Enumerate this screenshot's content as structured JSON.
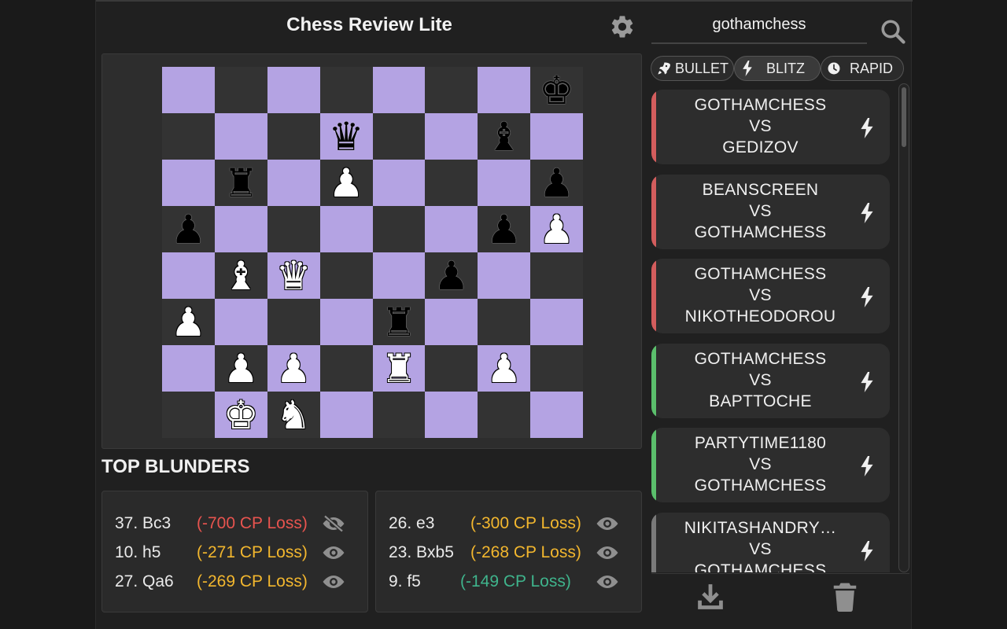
{
  "header": {
    "title": "Chess Review Lite",
    "settings_icon": "gear-icon"
  },
  "colors": {
    "light_square": "#b4a3e3",
    "dark_square": "#333333",
    "loss_red": "#e8544f",
    "loss_orange": "#f3b72e",
    "loss_green": "#3fb48c",
    "win_stripe": "#5bbf6c",
    "loss_stripe": "#d35d5d",
    "draw_stripe": "#7a7a7a"
  },
  "board": {
    "ranks": [
      [
        "",
        "",
        "",
        "",
        "",
        "",
        "",
        "bk"
      ],
      [
        "",
        "",
        "",
        "bq",
        "",
        "",
        "bb",
        ""
      ],
      [
        "",
        "br",
        "",
        "wp",
        "",
        "",
        "",
        "bp"
      ],
      [
        "bp",
        "",
        "",
        "",
        "",
        "",
        "bp",
        "wp"
      ],
      [
        "",
        "wb",
        "wq",
        "",
        "",
        "bp",
        "",
        ""
      ],
      [
        "wp",
        "",
        "",
        "",
        "br",
        "",
        "",
        ""
      ],
      [
        "",
        "wp",
        "wp",
        "",
        "wr",
        "",
        "wp",
        ""
      ],
      [
        "",
        "wk",
        "wn",
        "",
        "",
        "",
        "",
        ""
      ]
    ]
  },
  "blunders": {
    "title": "TOP BLUNDERS",
    "left": [
      {
        "move": "37. Bc3",
        "loss": "(-700 CP Loss)",
        "severity": "red",
        "icon": "eye-slash-icon"
      },
      {
        "move": "10. h5",
        "loss": "(-271 CP Loss)",
        "severity": "orange",
        "icon": "eye-icon"
      },
      {
        "move": "27. Qa6",
        "loss": "(-269 CP Loss)",
        "severity": "orange",
        "icon": "eye-icon"
      }
    ],
    "right": [
      {
        "move": "26. e3",
        "loss": "(-300 CP Loss)",
        "severity": "orange",
        "icon": "eye-icon"
      },
      {
        "move": "23. Bxb5",
        "loss": "(-268 CP Loss)",
        "severity": "orange",
        "icon": "eye-icon"
      },
      {
        "move": "9. f5",
        "loss": "(-149 CP Loss)",
        "severity": "green",
        "icon": "eye-icon"
      }
    ]
  },
  "search": {
    "value": "gothamchess",
    "icon": "search-icon"
  },
  "modes": [
    {
      "label": "BULLET",
      "icon": "rocket-icon"
    },
    {
      "label": "BLITZ",
      "icon": "bolt-icon",
      "selected": true
    },
    {
      "label": "RAPID",
      "icon": "clock-icon"
    }
  ],
  "games": [
    {
      "white": "GOTHAMCHESS",
      "vs": "VS",
      "black": "GEDIZOV",
      "result": "loss",
      "icon": "bolt-icon"
    },
    {
      "white": "BEANSCREEN",
      "vs": "VS",
      "black": "GOTHAMCHESS",
      "result": "loss",
      "icon": "bolt-icon"
    },
    {
      "white": "GOTHAMCHESS",
      "vs": "VS",
      "black": "NIKOTHEODOROU",
      "result": "loss",
      "icon": "bolt-icon"
    },
    {
      "white": "GOTHAMCHESS",
      "vs": "VS",
      "black": "BAPTTOCHE",
      "result": "win",
      "icon": "bolt-icon"
    },
    {
      "white": "PARTYTIME1180",
      "vs": "VS",
      "black": "GOTHAMCHESS",
      "result": "win",
      "icon": "bolt-icon"
    },
    {
      "white": "NIKITASHANDRY…",
      "vs": "VS",
      "black": "GOTHAMCHESS",
      "result": "draw",
      "icon": "bolt-icon"
    }
  ],
  "footer": {
    "download_icon": "download-icon",
    "delete_icon": "trash-icon"
  }
}
